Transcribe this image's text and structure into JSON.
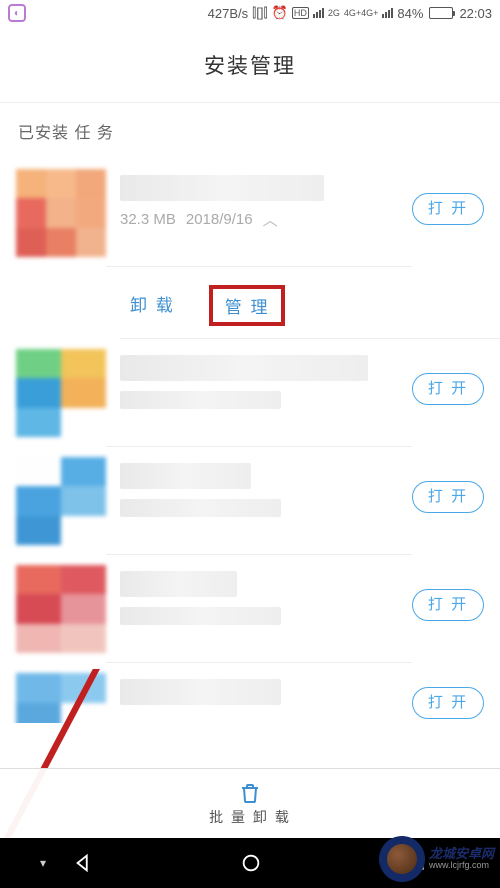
{
  "status": {
    "speed": "427B/s",
    "net2g": "2G",
    "net4g": "4G+4G+",
    "battery_pct": "84%",
    "time": "22:03",
    "hd": "HD"
  },
  "page": {
    "title": "安装管理",
    "section": "已安装 任 务"
  },
  "apps": [
    {
      "size": "32.3 MB",
      "date": "2018/9/16",
      "open": "打 开",
      "expanded": true
    },
    {
      "open": "打 开"
    },
    {
      "open": "打 开"
    },
    {
      "open": "打 开"
    },
    {
      "open": "打 开"
    }
  ],
  "actions": {
    "uninstall": "卸 载",
    "manage": "管 理"
  },
  "bottom": {
    "batch_uninstall": "批 量 卸 载"
  },
  "watermark": {
    "title": "龙城安卓网",
    "url": "www.lcjrfg.com"
  }
}
